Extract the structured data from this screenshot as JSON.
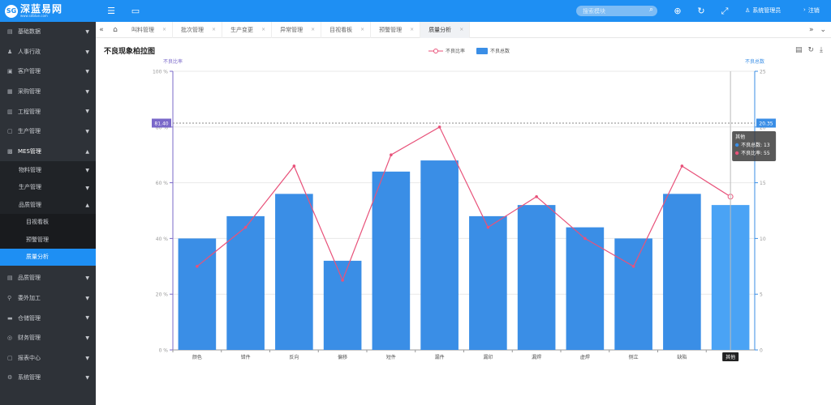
{
  "app": {
    "logo_mark": "SG",
    "logo_name": "深蓝易网",
    "logo_url": "www.sdblue.com"
  },
  "topbar": {
    "search_placeholder": "搜索模块",
    "user_label": "系统管理员",
    "logout_label": "注销"
  },
  "sidebar": {
    "items": [
      {
        "label": "基础数据"
      },
      {
        "label": "人事行政"
      },
      {
        "label": "客户管理"
      },
      {
        "label": "采购管理"
      },
      {
        "label": "工程管理"
      },
      {
        "label": "生产管理"
      },
      {
        "label": "MES管理"
      }
    ],
    "mes_sub": [
      {
        "label": "物料管理"
      },
      {
        "label": "生产管理"
      },
      {
        "label": "品质管理"
      }
    ],
    "quality_sub": [
      {
        "label": "目视看板"
      },
      {
        "label": "预警管理"
      },
      {
        "label": "质量分析"
      }
    ],
    "items_after": [
      {
        "label": "品质管理"
      },
      {
        "label": "委外加工"
      },
      {
        "label": "仓储管理"
      },
      {
        "label": "财务管理"
      },
      {
        "label": "报表中心"
      },
      {
        "label": "系统管理"
      }
    ]
  },
  "tabs": [
    {
      "label": "叫料管理"
    },
    {
      "label": "批次管理"
    },
    {
      "label": "生产变更"
    },
    {
      "label": "异常管理"
    },
    {
      "label": "目视看板"
    },
    {
      "label": "预警管理"
    },
    {
      "label": "质量分析"
    }
  ],
  "chart_data": {
    "type": "bar",
    "title": "不良现象柏拉图",
    "categories": [
      "颜色",
      "错件",
      "反向",
      "偏移",
      "短件",
      "漏件",
      "漏印",
      "漏焊",
      "虚焊",
      "侧立",
      "缺陷",
      "其他"
    ],
    "series": [
      {
        "name": "不良比率",
        "type": "line",
        "axis": "left",
        "values": [
          30,
          44,
          66,
          25,
          70,
          80,
          44,
          55,
          40,
          30,
          66,
          55
        ]
      },
      {
        "name": "不良总数",
        "type": "bar",
        "axis": "right",
        "values": [
          10,
          12,
          14,
          8,
          16,
          17,
          12,
          13,
          11,
          10,
          14,
          13
        ]
      }
    ],
    "y_left": {
      "label": "不良比率",
      "min": 0,
      "max": 100,
      "ticks": [
        "0 %",
        "20 %",
        "40 %",
        "60 %",
        "80 %",
        "100 %"
      ]
    },
    "y_right": {
      "label": "不良总数",
      "min": 0,
      "max": 25,
      "ticks": [
        "0",
        "5",
        "10",
        "15",
        "20",
        "25"
      ]
    },
    "crosshair": {
      "left_value": "81.40",
      "right_value": "20.35",
      "category": "其他"
    },
    "tooltip": {
      "title": "其他",
      "rows": [
        "不良总数: 13",
        "不良比率: 55"
      ]
    },
    "colors": {
      "bar": "#3a8ee6",
      "bar_active": "#4aa3f5",
      "line": "#e8527a",
      "left_axis": "#7a68c9",
      "right_axis": "#3a8ee6"
    },
    "legend_position": "top-center",
    "grid": true
  }
}
